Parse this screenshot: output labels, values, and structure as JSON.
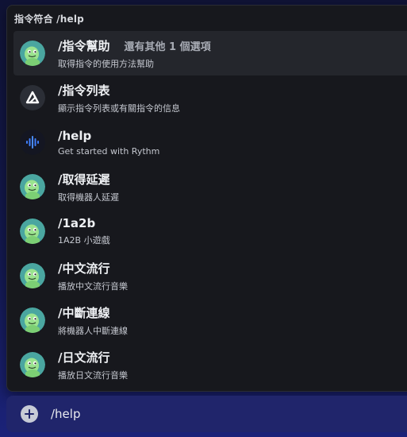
{
  "popup": {
    "header": "指令符合 /help",
    "items": [
      {
        "name": "/指令幫助",
        "extra": "還有其他 1 個選項",
        "desc": "取得指令的使用方法幫助",
        "icon": "turtle-bot-avatar-icon",
        "selected": true
      },
      {
        "name": "/指令列表",
        "extra": "",
        "desc": "顯示指令列表或有關指令的信息",
        "icon": "triangle-logo-avatar-icon",
        "selected": false
      },
      {
        "name": "/help",
        "extra": "",
        "desc": "Get started with Rythm",
        "icon": "rythm-soundwave-avatar-icon",
        "selected": false
      },
      {
        "name": "/取得延遲",
        "extra": "",
        "desc": "取得機器人延遲",
        "icon": "turtle-bot-avatar-icon",
        "selected": false
      },
      {
        "name": "/1a2b",
        "extra": "",
        "desc": "1A2B 小遊戲",
        "icon": "turtle-bot-avatar-icon",
        "selected": false
      },
      {
        "name": "/中文流行",
        "extra": "",
        "desc": "播放中文流行音樂",
        "icon": "turtle-bot-avatar-icon",
        "selected": false
      },
      {
        "name": "/中斷連線",
        "extra": "",
        "desc": "將機器人中斷連線",
        "icon": "turtle-bot-avatar-icon",
        "selected": false
      },
      {
        "name": "/日文流行",
        "extra": "",
        "desc": "播放日文流行音樂",
        "icon": "turtle-bot-avatar-icon",
        "selected": false
      }
    ]
  },
  "input": {
    "value": "/help",
    "plus_icon": "plus-circle-icon"
  },
  "colors": {
    "popup_bg": "#17181d",
    "selected_bg": "#24262c",
    "input_bg": "#20256b",
    "turtle_green": "#9be38f",
    "turtle_bg": "#4aa6a0",
    "rythm_blue": "#3f7fff"
  }
}
